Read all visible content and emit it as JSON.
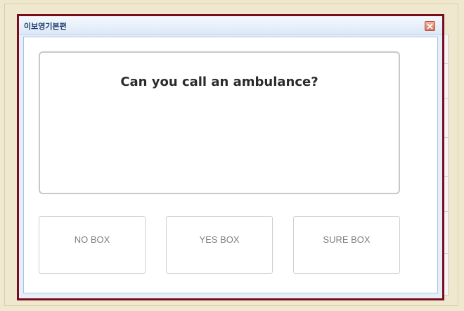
{
  "window": {
    "title": "이보영기본편",
    "close_icon": "close-icon"
  },
  "question": {
    "text": "Can you call an ambulance?"
  },
  "answers": [
    {
      "label": "NO BOX"
    },
    {
      "label": "YES BOX"
    },
    {
      "label": "SURE BOX"
    }
  ],
  "colors": {
    "window_border": "#7a0d1d",
    "background": "#efe8cf",
    "title_text": "#1a3c6e",
    "close_button": "#d9725a"
  }
}
